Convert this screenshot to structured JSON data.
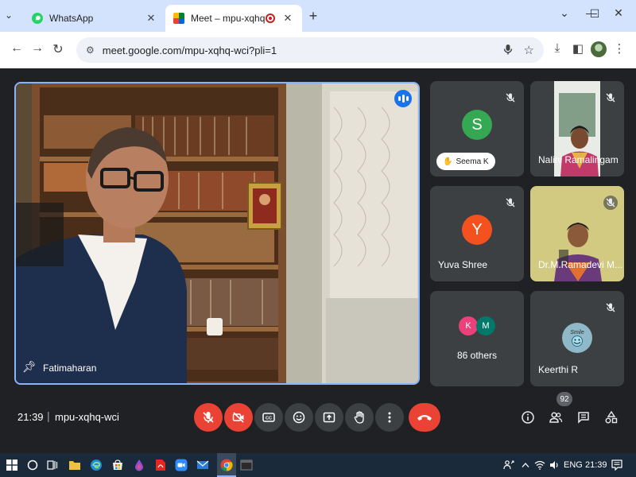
{
  "browser": {
    "tabs": [
      {
        "title": "WhatsApp",
        "icon": "whatsapp-icon",
        "active": false
      },
      {
        "title": "Meet – mpu-xqhq-wci",
        "icon": "google-meet-icon",
        "active": true
      }
    ],
    "url": "meet.google.com/mpu-xqhq-wci?pli=1"
  },
  "meet": {
    "main_speaker": {
      "name": "Fatimaharan"
    },
    "participants": [
      {
        "name": "Seema K",
        "initial": "S",
        "color": "#34a853",
        "hand_raised": true
      },
      {
        "name": "Nalini Ramalingam",
        "has_video": true
      },
      {
        "name": "Yuva Shree",
        "initial": "Y",
        "color": "#f4511e"
      },
      {
        "name": "Dr.M.Ramadevi M...",
        "has_video": true
      },
      {
        "others_label": "86 others",
        "initials": [
          "K",
          "M"
        ],
        "colors": [
          "#ec407a",
          "#00796b"
        ]
      },
      {
        "name": "Keerthi R",
        "avatar_text": "Smile"
      }
    ],
    "time": "21:39",
    "meeting_code": "mpu-xqhq-wci",
    "people_count": "92"
  },
  "taskbar": {
    "language": "ENG",
    "time": "21:39"
  },
  "colors": {
    "accent": "#8ab4f8",
    "danger": "#ea4335",
    "tile_bg": "#3c4043",
    "meet_bg": "#202124"
  }
}
